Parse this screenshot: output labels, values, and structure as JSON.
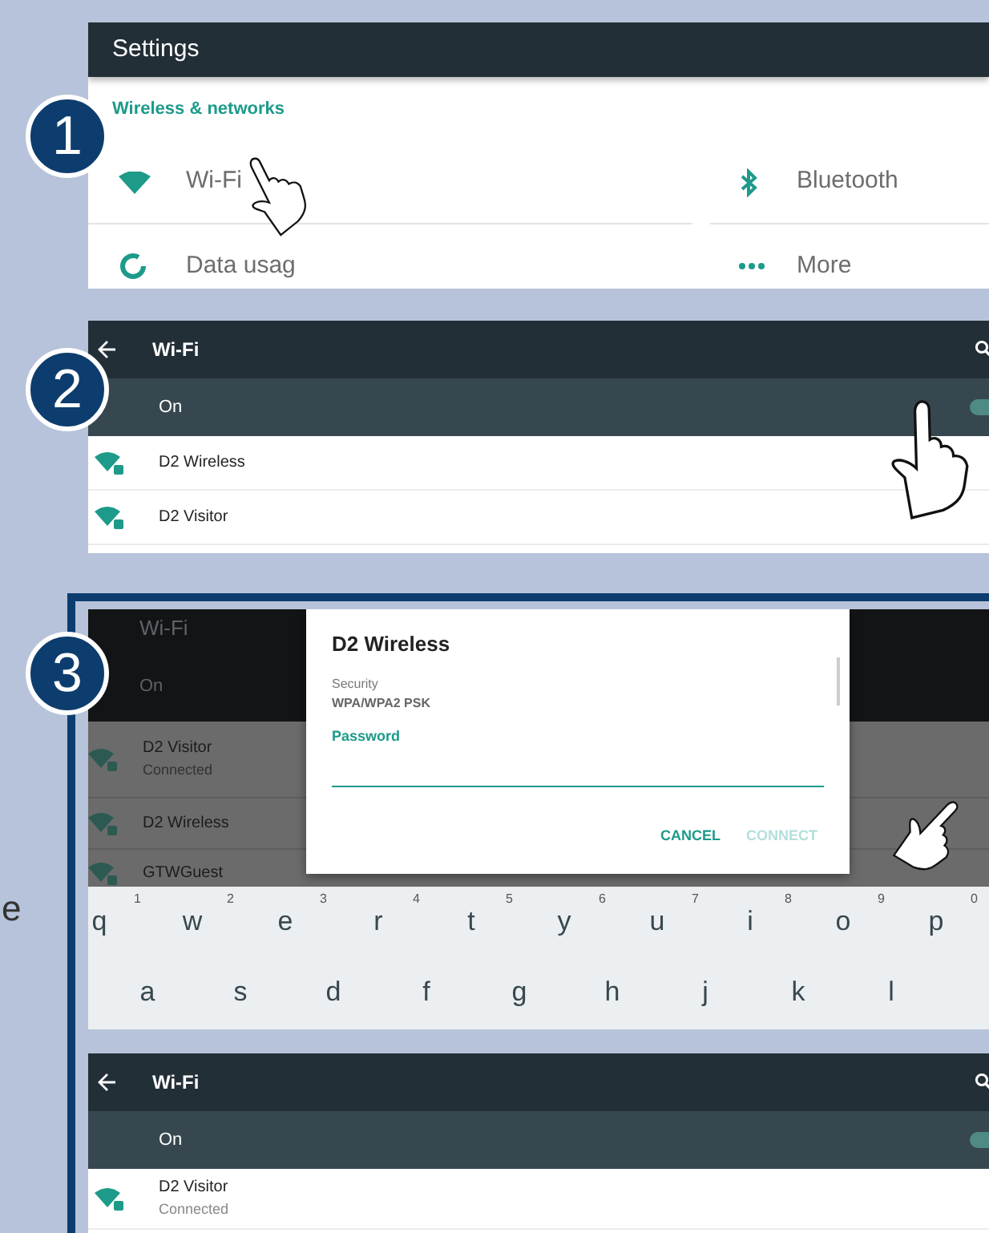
{
  "page_fragment": "e",
  "settings_panel": {
    "step": "1",
    "title": "Settings",
    "section": "Wireless & networks",
    "items": [
      {
        "kind": "wifi",
        "label": "Wi-Fi"
      },
      {
        "kind": "bluetooth",
        "label": "Bluetooth"
      },
      {
        "kind": "data",
        "label": "Data usag"
      },
      {
        "kind": "more",
        "label": "More"
      }
    ]
  },
  "wifi_panel": {
    "step": "2",
    "title": "Wi-Fi",
    "switch": {
      "label": "On",
      "on": true
    },
    "networks": [
      {
        "name": "D2 Wireless"
      },
      {
        "name": "D2 Visitor"
      }
    ]
  },
  "connect_panel": {
    "step": "3",
    "background": {
      "title": "Wi-Fi",
      "switch_label": "On",
      "networks": [
        {
          "name": "D2 Visitor",
          "status": "Connected"
        },
        {
          "name": "D2 Wireless"
        },
        {
          "name": "GTWGuest"
        }
      ]
    },
    "dialog": {
      "title": "D2 Wireless",
      "security_label": "Security",
      "security_value": "WPA/WPA2 PSK",
      "password_label": "Password",
      "buttons": [
        {
          "label": "CANCEL",
          "disabled": false
        },
        {
          "label": "CONNECT",
          "disabled": true
        }
      ]
    },
    "keyboard": {
      "rows": [
        [
          {
            "key": "q",
            "hint": "1"
          },
          {
            "key": "w",
            "hint": "2"
          },
          {
            "key": "e",
            "hint": "3"
          },
          {
            "key": "r",
            "hint": "4"
          },
          {
            "key": "t",
            "hint": "5"
          },
          {
            "key": "y",
            "hint": "6"
          },
          {
            "key": "u",
            "hint": "7"
          },
          {
            "key": "i",
            "hint": "8"
          },
          {
            "key": "o",
            "hint": "9"
          },
          {
            "key": "p",
            "hint": "0"
          }
        ],
        [
          {
            "key": "a"
          },
          {
            "key": "s"
          },
          {
            "key": "d"
          },
          {
            "key": "f"
          },
          {
            "key": "g"
          },
          {
            "key": "h"
          },
          {
            "key": "j"
          },
          {
            "key": "k"
          },
          {
            "key": "l"
          }
        ]
      ]
    }
  },
  "result_panel": {
    "title": "Wi-Fi",
    "switch": {
      "label": "On",
      "on": true
    },
    "networks": [
      {
        "name": "D2 Visitor",
        "status": "Connected"
      }
    ]
  }
}
